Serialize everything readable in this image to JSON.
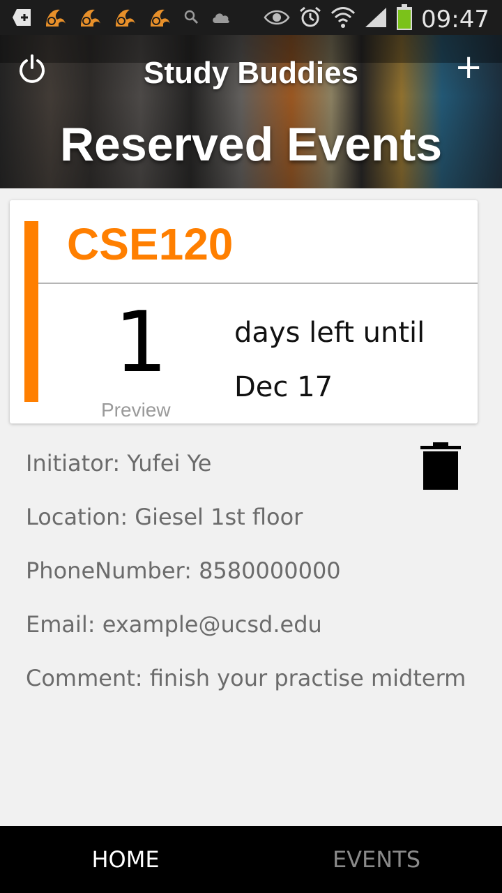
{
  "status_bar": {
    "time": "09:47",
    "icons": [
      "add-notification-icon",
      "uc-browser-icon",
      "uc-browser-icon",
      "uc-browser-icon",
      "uc-browser-icon",
      "search-icon",
      "cloud-icon",
      "eye-icon",
      "alarm-icon",
      "wifi-icon",
      "signal-icon",
      "battery-icon"
    ],
    "battery_color": "#7bc21a"
  },
  "header": {
    "app_title": "Study Buddies",
    "page_title": "Reserved Events",
    "power_icon": "power-icon",
    "add_label": "+"
  },
  "event": {
    "course": "CSE120",
    "days_left": "1",
    "days_label": "days left until",
    "date": "Dec 17",
    "preview_label": "Preview",
    "accent_color": "#ff7f00"
  },
  "details": {
    "initiator": "Initiator: Yufei Ye",
    "location": "Location: Giesel 1st floor",
    "phone": "PhoneNumber: 8580000000",
    "email": "Email: example@ucsd.edu",
    "comment": "Comment: finish your practise midterm"
  },
  "tabs": {
    "home": "HOME",
    "events": "EVENTS"
  }
}
